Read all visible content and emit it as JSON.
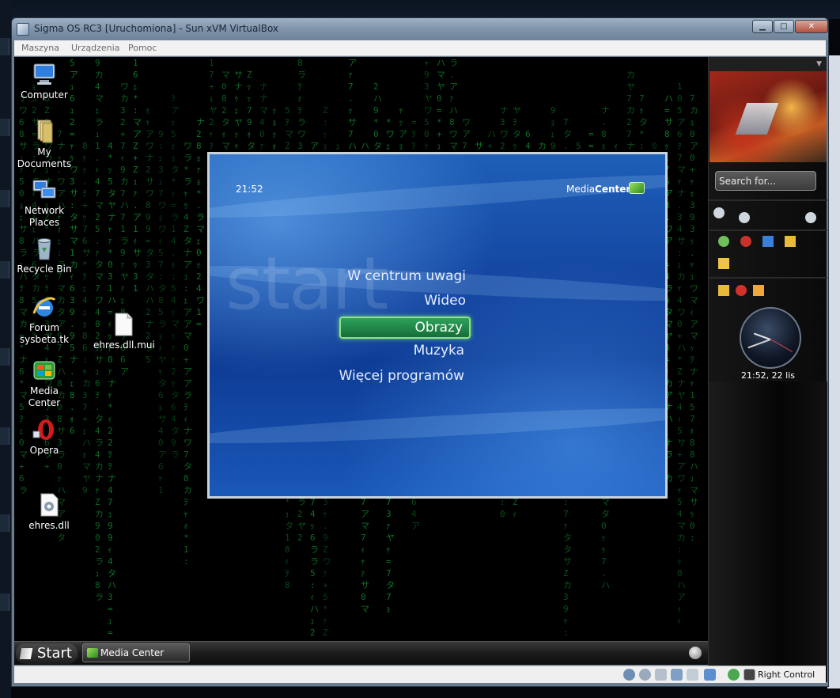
{
  "vbox": {
    "title": "Sigma OS RC3 [Uruchomiona] - Sun xVM VirtualBox",
    "menu": [
      "Maszyna",
      "Urządzenia",
      "Pomoc"
    ],
    "host_key": "Right Control"
  },
  "desktop_icons": [
    {
      "label": "Computer",
      "icon": "computer-icon"
    },
    {
      "label": "My Documents",
      "icon": "folder-icon"
    },
    {
      "label": "Network Places",
      "icon": "network-icon"
    },
    {
      "label": "Recycle Bin",
      "icon": "recycle-bin-icon"
    },
    {
      "label": "Forum sysbeta.tk",
      "icon": "internet-explorer-icon"
    },
    {
      "label": "ehres.dll.mui",
      "icon": "file-icon"
    },
    {
      "label": "Media Center",
      "icon": "media-center-icon"
    },
    {
      "label": "Opera",
      "icon": "opera-icon"
    },
    {
      "label": "ehres.dll",
      "icon": "settings-file-icon"
    }
  ],
  "media_center": {
    "time": "21:52",
    "brand_light": "Media",
    "brand_bold": "Center",
    "background_word": "start",
    "menu": [
      "W centrum uwagi",
      "Wideo",
      "Obrazy",
      "Muzyka",
      "Więcej programów"
    ],
    "selected": "Obrazy"
  },
  "sidebar": {
    "search_placeholder": "Search for...",
    "clock_caption": "21:52, 22 lis"
  },
  "taskbar": {
    "start_label": "Start",
    "task_label": "Media Center"
  },
  "colors": {
    "mc_blue": "#1447a2",
    "selection_green": "#2ea25c",
    "matrix_green": "#0f7a2b"
  }
}
